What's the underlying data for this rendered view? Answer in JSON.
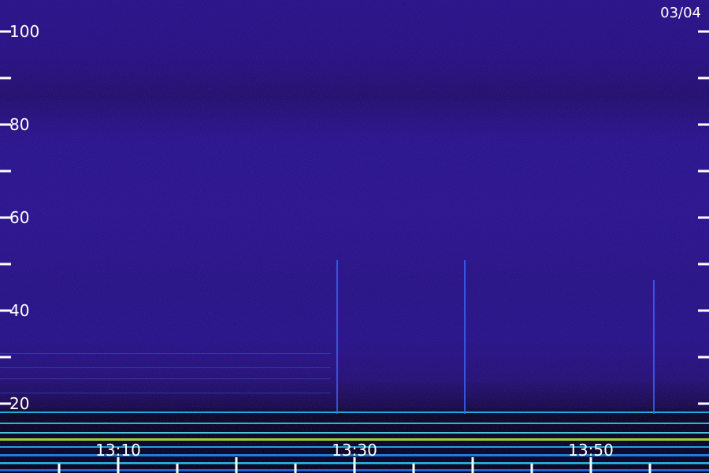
{
  "chart_data": {
    "type": "heatmap",
    "title": "",
    "date_label": "03/04",
    "y_ticks_labeled": [
      "20",
      "40",
      "60",
      "80",
      "100"
    ],
    "y_range": [
      0,
      100
    ],
    "x_ticks_labeled": [
      "13:10",
      "13:30",
      "13:50"
    ],
    "colormap": [
      "#000000",
      "#2a148a",
      "#1f5dff",
      "#22d7ff",
      "#c8ff3a"
    ],
    "background_color": "#2a148a",
    "grid": false
  }
}
